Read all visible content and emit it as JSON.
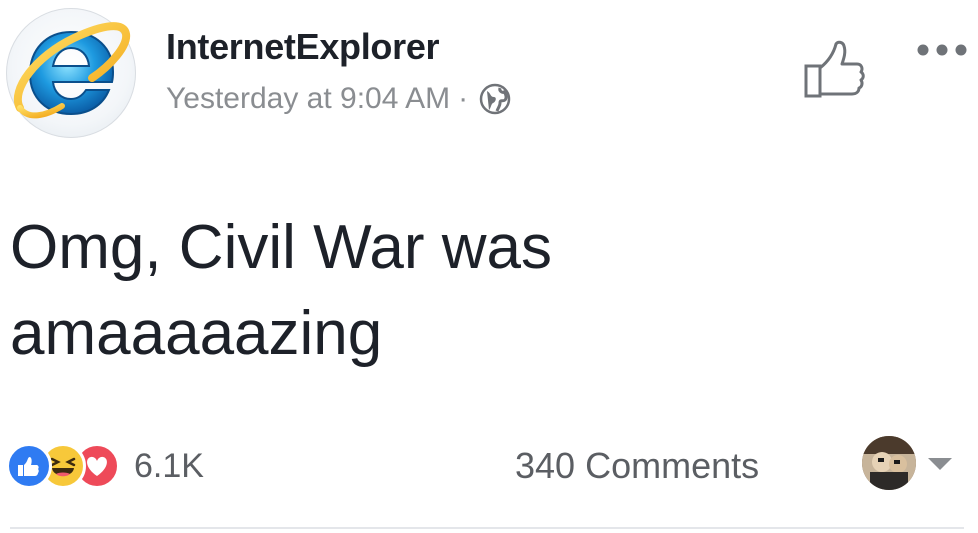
{
  "post": {
    "author": "InternetExplorer",
    "timestamp": "Yesterday at 9:04 AM",
    "separator": "·",
    "privacy_icon": "globe-icon",
    "text": "Omg, Civil War was\namaaaaazing"
  },
  "header_actions": {
    "like_icon": "thumbs-up-outline-icon",
    "more_icon": "more-dots-icon"
  },
  "footer": {
    "reactions": [
      "like",
      "haha",
      "love"
    ],
    "reaction_count": "6.1K",
    "comments_label": "340 Comments"
  },
  "colors": {
    "text": "#1d2129",
    "meta": "#8a8d91",
    "like_blue": "#2f7bf2",
    "haha_yellow": "#f7c83a",
    "love_red": "#ee4a59"
  }
}
